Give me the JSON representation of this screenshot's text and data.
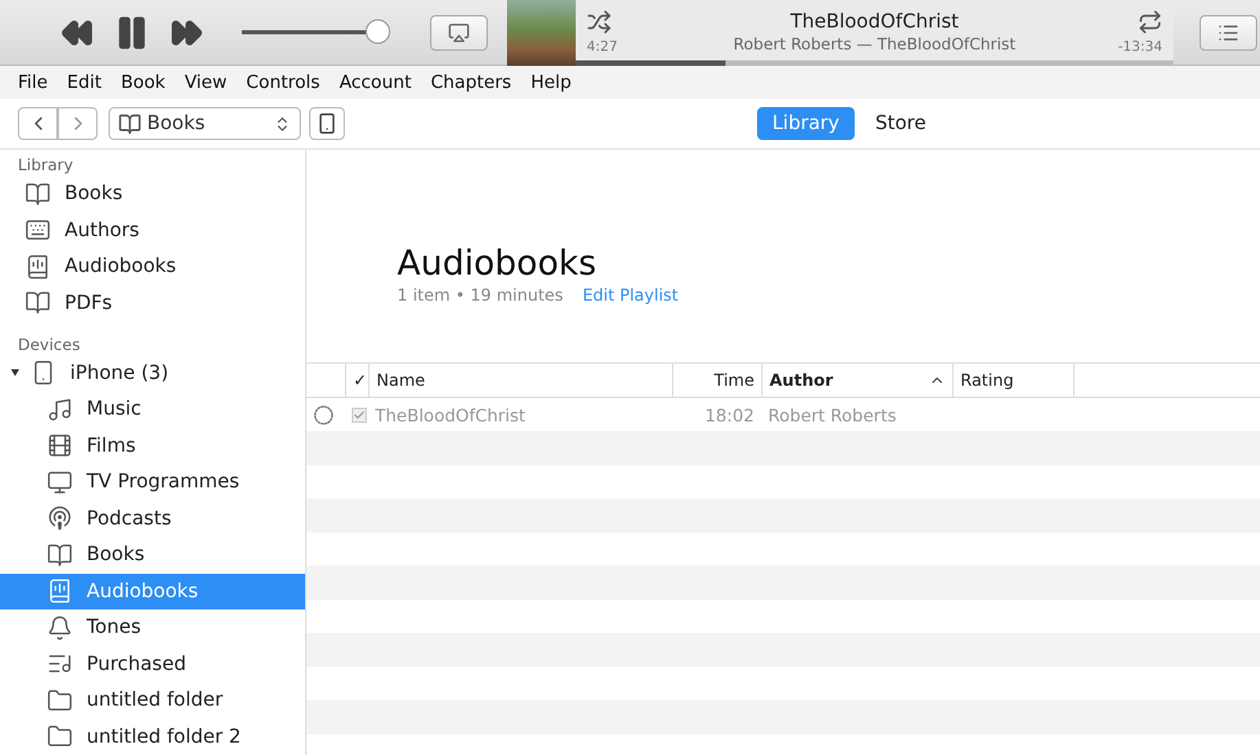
{
  "player": {
    "volume": {
      "level": 0.93
    },
    "now_playing": {
      "title": "TheBloodOfChrist",
      "subtitle": "Robert Roberts — TheBloodOfChrist",
      "elapsed": "4:27",
      "remaining": "-13:34",
      "level": 0.25
    }
  },
  "menu": [
    "File",
    "Edit",
    "Book",
    "View",
    "Controls",
    "Account",
    "Chapters",
    "Help"
  ],
  "toolbar": {
    "media_select": "Books",
    "tabs": [
      {
        "label": "Library",
        "selected": true
      },
      {
        "label": "Store",
        "selected": false
      }
    ]
  },
  "sidebar": [
    {
      "heading": "Library",
      "items": [
        {
          "label": "Books",
          "kind": "book",
          "selected": false
        },
        {
          "label": "Authors",
          "kind": "authors",
          "selected": false
        },
        {
          "label": "Audiobooks",
          "kind": "audiobook",
          "selected": false
        },
        {
          "label": "PDFs",
          "kind": "book",
          "selected": false
        }
      ]
    },
    {
      "heading": "Devices",
      "items": [
        {
          "label": "iPhone (3)",
          "kind": "phone",
          "selected": false,
          "expanded": true,
          "children": [
            {
              "label": "Music",
              "kind": "music",
              "selected": false
            },
            {
              "label": "Films",
              "kind": "film",
              "selected": false
            },
            {
              "label": "TV Programmes",
              "kind": "tv",
              "selected": false
            },
            {
              "label": "Podcasts",
              "kind": "podcast",
              "selected": false
            },
            {
              "label": "Books",
              "kind": "book",
              "selected": false
            },
            {
              "label": "Audiobooks",
              "kind": "audiobook",
              "selected": true
            },
            {
              "label": "Tones",
              "kind": "tone",
              "selected": false
            },
            {
              "label": "Purchased",
              "kind": "purchased",
              "selected": false
            },
            {
              "label": "untitled folder",
              "kind": "folder",
              "selected": false
            },
            {
              "label": "untitled folder 2",
              "kind": "folder",
              "selected": false
            }
          ]
        }
      ]
    }
  ],
  "content": {
    "title": "Audiobooks",
    "summary": "1 item • 19 minutes",
    "edit_link": "Edit Playlist",
    "table": {
      "columns": [
        {
          "label": "✓"
        },
        {
          "label": "Name",
          "sorted": false
        },
        {
          "label": "Time",
          "sorted": false
        },
        {
          "label": "Author",
          "sorted": true
        },
        {
          "label": "Rating",
          "sorted": false
        }
      ],
      "rows": [
        {
          "checked": true,
          "cells": [
            "",
            "TheBloodOfChrist",
            "18:02",
            "Robert Roberts",
            ""
          ]
        }
      ]
    }
  }
}
